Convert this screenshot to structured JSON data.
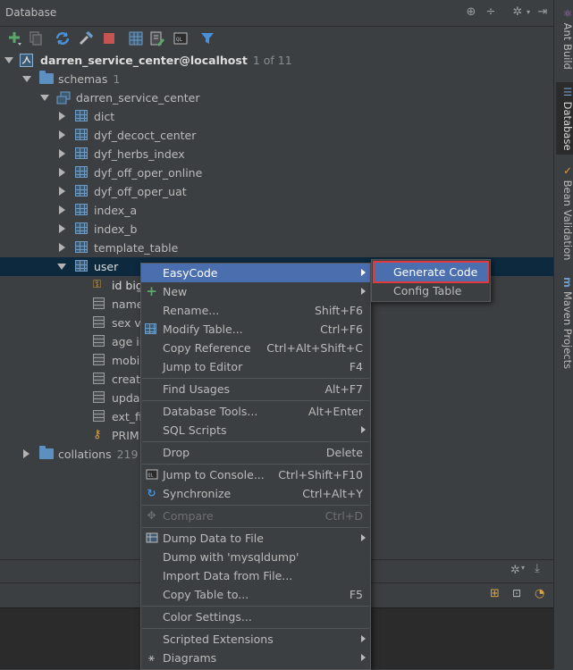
{
  "panel": {
    "title": "Database"
  },
  "tree": {
    "connection": {
      "label": "darren_service_center@localhost",
      "count": "1 of 11"
    },
    "schemas": {
      "label": "schemas",
      "count": "1"
    },
    "schema": {
      "label": "darren_service_center"
    },
    "tables": [
      "dict",
      "dyf_decoct_center",
      "dyf_herbs_index",
      "dyf_off_oper_online",
      "dyf_off_oper_uat",
      "index_a",
      "index_b",
      "template_table",
      "user"
    ],
    "user_children": [
      "id big",
      "name",
      "sex va",
      "age in",
      "mobil",
      "create",
      "upda",
      "ext_fie",
      "PRIM"
    ],
    "collations": {
      "label": "collations",
      "count": "219"
    }
  },
  "side_tabs": [
    "Ant Build",
    "Database",
    "Bean Validation",
    "Maven Projects"
  ],
  "context_menu": {
    "items": [
      {
        "label": "EasyCode",
        "shortcut": "",
        "submenu": true
      },
      {
        "label": "New",
        "shortcut": "",
        "submenu": true
      },
      {
        "label": "Rename...",
        "shortcut": "Shift+F6"
      },
      {
        "label": "Modify Table...",
        "shortcut": "Ctrl+F6"
      },
      {
        "label": "Copy Reference",
        "shortcut": "Ctrl+Alt+Shift+C"
      },
      {
        "label": "Jump to Editor",
        "shortcut": "F4"
      },
      {
        "label": "Find Usages",
        "shortcut": "Alt+F7"
      },
      {
        "label": "Database Tools...",
        "shortcut": "Alt+Enter"
      },
      {
        "label": "SQL Scripts",
        "shortcut": "",
        "submenu": true
      },
      {
        "label": "Drop",
        "shortcut": "Delete"
      },
      {
        "label": "Jump to Console...",
        "shortcut": "Ctrl+Shift+F10"
      },
      {
        "label": "Synchronize",
        "shortcut": "Ctrl+Alt+Y"
      },
      {
        "label": "Compare",
        "shortcut": "Ctrl+D",
        "disabled": true
      },
      {
        "label": "Dump Data to File",
        "shortcut": "",
        "submenu": true
      },
      {
        "label": "Dump with 'mysqldump'",
        "shortcut": ""
      },
      {
        "label": "Import Data from File...",
        "shortcut": ""
      },
      {
        "label": "Copy Table to...",
        "shortcut": "F5"
      },
      {
        "label": "Color Settings...",
        "shortcut": ""
      },
      {
        "label": "Scripted Extensions",
        "shortcut": "",
        "submenu": true
      },
      {
        "label": "Diagrams",
        "shortcut": "",
        "submenu": true
      }
    ]
  },
  "submenu": {
    "items": [
      "Generate Code",
      "Config Table"
    ]
  }
}
